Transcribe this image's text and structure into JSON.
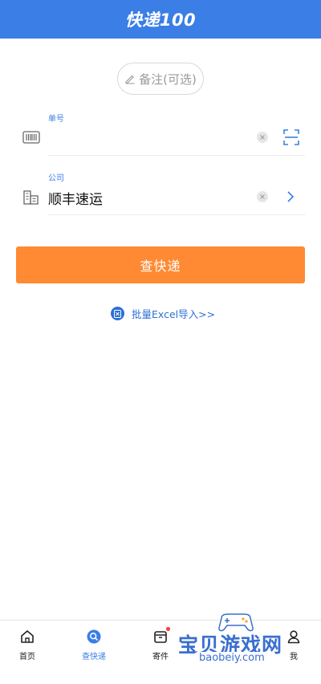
{
  "header": {
    "title": "快递100"
  },
  "remark": {
    "label": "备注(可选)"
  },
  "tracking_field": {
    "label": "单号",
    "value": ""
  },
  "company_field": {
    "label": "公司",
    "value": "顺丰速运"
  },
  "query_button": {
    "label": "查快递"
  },
  "excel_import": {
    "label": "批量Excel导入>>"
  },
  "tabs": [
    {
      "label": "首页",
      "icon": "home-icon",
      "active": false
    },
    {
      "label": "查快递",
      "icon": "search-icon",
      "active": true
    },
    {
      "label": "寄件",
      "icon": "parcel-icon",
      "active": false,
      "badge": true
    },
    {
      "label": "我",
      "icon": "user-icon",
      "active": false
    }
  ],
  "watermark": {
    "title": "宝贝游戏网",
    "url": "baobeiy.com"
  },
  "colors": {
    "brand_blue": "#3a7ee6",
    "action_orange": "#ff8a33"
  }
}
